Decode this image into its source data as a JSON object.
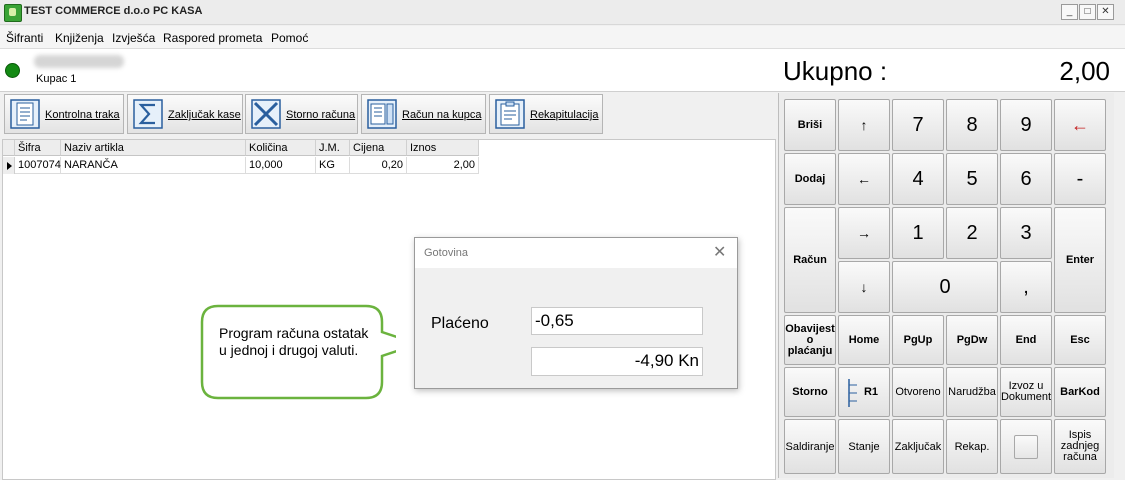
{
  "window": {
    "title": "TEST COMMERCE d.o.o PC KASA"
  },
  "menu": [
    "Šifranti",
    "Knjiženja",
    "Izvješća",
    "Raspored prometa",
    "Pomoć"
  ],
  "info": {
    "customer": "Kupac 1",
    "total_label": "Ukupno :",
    "total_value": "2,00",
    "status_color": "#148a14"
  },
  "toolbar": [
    {
      "label": "Kontrolna traka",
      "icon": "document-icon"
    },
    {
      "label": "Zaključak kase",
      "icon": "sigma-icon"
    },
    {
      "label": "Storno računa",
      "icon": "x-icon"
    },
    {
      "label": "Račun na kupca",
      "icon": "receipt-icon"
    },
    {
      "label": "Rekapitulacija",
      "icon": "clipboard-icon"
    }
  ],
  "grid": {
    "columns": [
      "Šifra",
      "Naziv artikla",
      "Količina",
      "J.M.",
      "Cijena",
      "Iznos"
    ],
    "rows": [
      [
        "1007074",
        "NARANČA",
        "10,000",
        "KG",
        "0,20",
        "2,00"
      ]
    ]
  },
  "keypad": [
    "Briši",
    "↑",
    "7",
    "8",
    "9",
    "←",
    "Dodaj",
    "←",
    "4",
    "5",
    "6",
    "-",
    "Račun",
    "→",
    "1",
    "2",
    "3",
    "Enter",
    "↓",
    "0",
    ",",
    "Obavijest o plaćanju",
    "Home",
    "PgUp",
    "PgDw",
    "End",
    "Esc",
    "Storno",
    "R1",
    "Otvoreno",
    "Narudžba",
    "Izvoz u Dokument",
    "BarKod",
    "Saldiranje",
    "Stanje",
    "Zaključak",
    "Rekap.",
    "",
    "Ispis zadnjeg računa"
  ],
  "dialog": {
    "title": "Gotovina",
    "paid_label": "Plaćeno",
    "paid_value": "-0,65",
    "remaining_value": "-4,90 Kn"
  },
  "callout": {
    "text": "Program računa ostatak u jednoj i drugoj valuti."
  }
}
